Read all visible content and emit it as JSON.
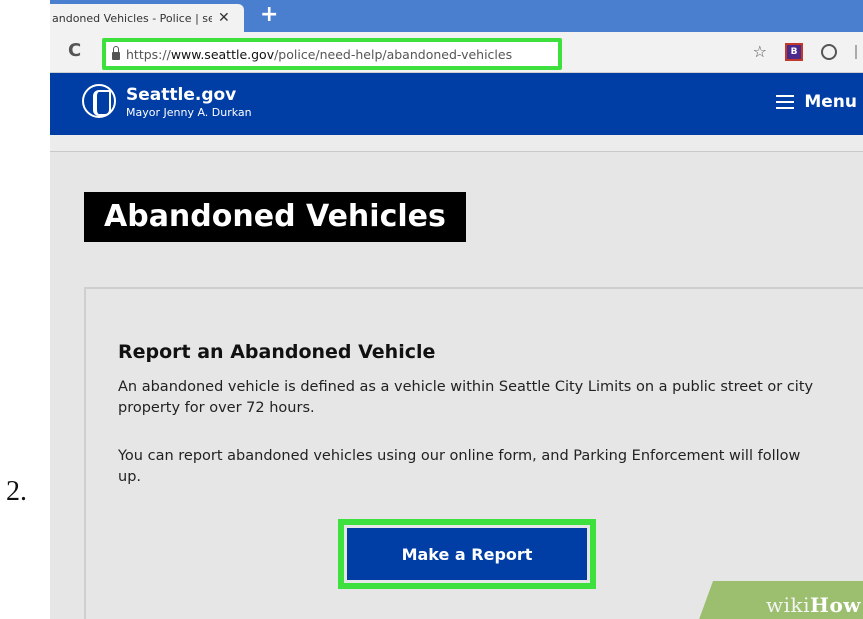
{
  "step_number": "2.",
  "browser": {
    "tab_title": "andoned Vehicles - Police | se",
    "tab_close": "✕",
    "new_tab": "+",
    "reload": "C",
    "url_scheme": "https://",
    "url_host": "www.seattle.gov",
    "url_path": "/police/need-help/abandoned-vehicles",
    "bookmark_star": "☆",
    "extension_b": "B"
  },
  "site_header": {
    "name": "Seattle.gov",
    "subtitle": "Mayor Jenny A. Durkan",
    "menu_label": "Menu"
  },
  "page": {
    "title": "Abandoned Vehicles",
    "card": {
      "heading": "Report an Abandoned Vehicle",
      "paragraph1": "An abandoned vehicle is defined as a vehicle within Seattle City Limits on a public street or city property for over 72 hours.",
      "paragraph2": "You can report abandoned vehicles using our online form, and Parking Enforcement will follow up.",
      "button_label": "Make a Report"
    }
  },
  "watermark": {
    "wiki": "wiki",
    "how": "How"
  },
  "colors": {
    "header_blue": "#003da5",
    "highlight_green": "#3ee03e",
    "tab_strip_blue": "#4a7fd0"
  },
  "icons": [
    "reload-icon",
    "lock-icon",
    "star-icon",
    "extension-b-icon",
    "gauge-icon",
    "seal-icon",
    "hamburger-icon"
  ]
}
